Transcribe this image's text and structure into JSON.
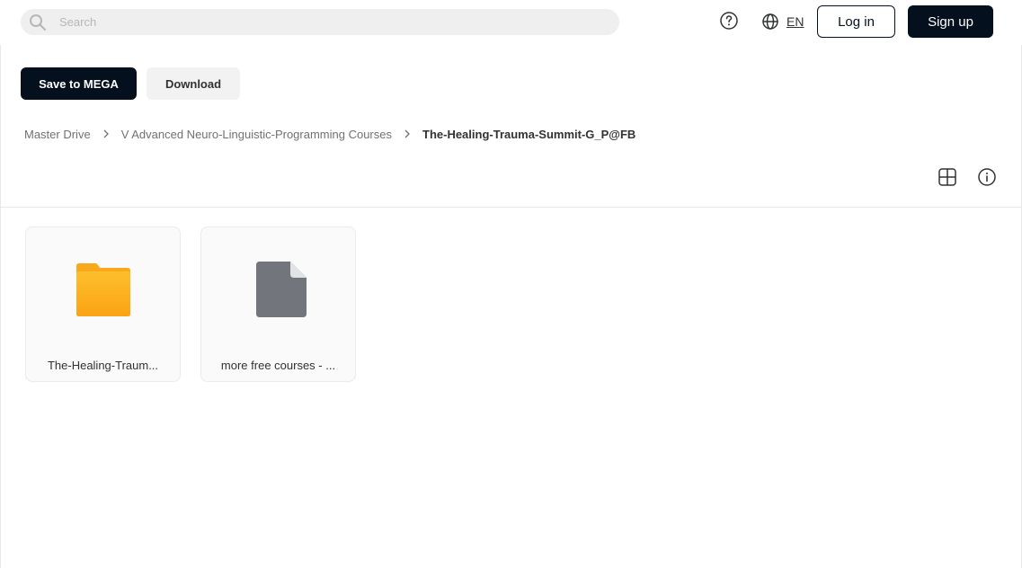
{
  "header": {
    "search": {
      "placeholder": "Search",
      "value": ""
    },
    "language": "EN",
    "login_label": "Log in",
    "signup_label": "Sign up"
  },
  "actions": {
    "save_label": "Save to MEGA",
    "download_label": "Download"
  },
  "breadcrumb": [
    {
      "label": "Master Drive"
    },
    {
      "label": "V Advanced Neuro-Linguistic-Programming Courses"
    },
    {
      "label": "The-Healing-Trauma-Summit-G_P@FB"
    }
  ],
  "items": [
    {
      "type": "folder",
      "icon": "folder-icon",
      "name": "The-Healing-Traum..."
    },
    {
      "type": "file",
      "icon": "file-icon",
      "name": "more free courses - ..."
    }
  ],
  "colors": {
    "primary": "#04101e",
    "folder": "#fdb022",
    "file": "#72757b",
    "search_bg": "#efefef"
  }
}
